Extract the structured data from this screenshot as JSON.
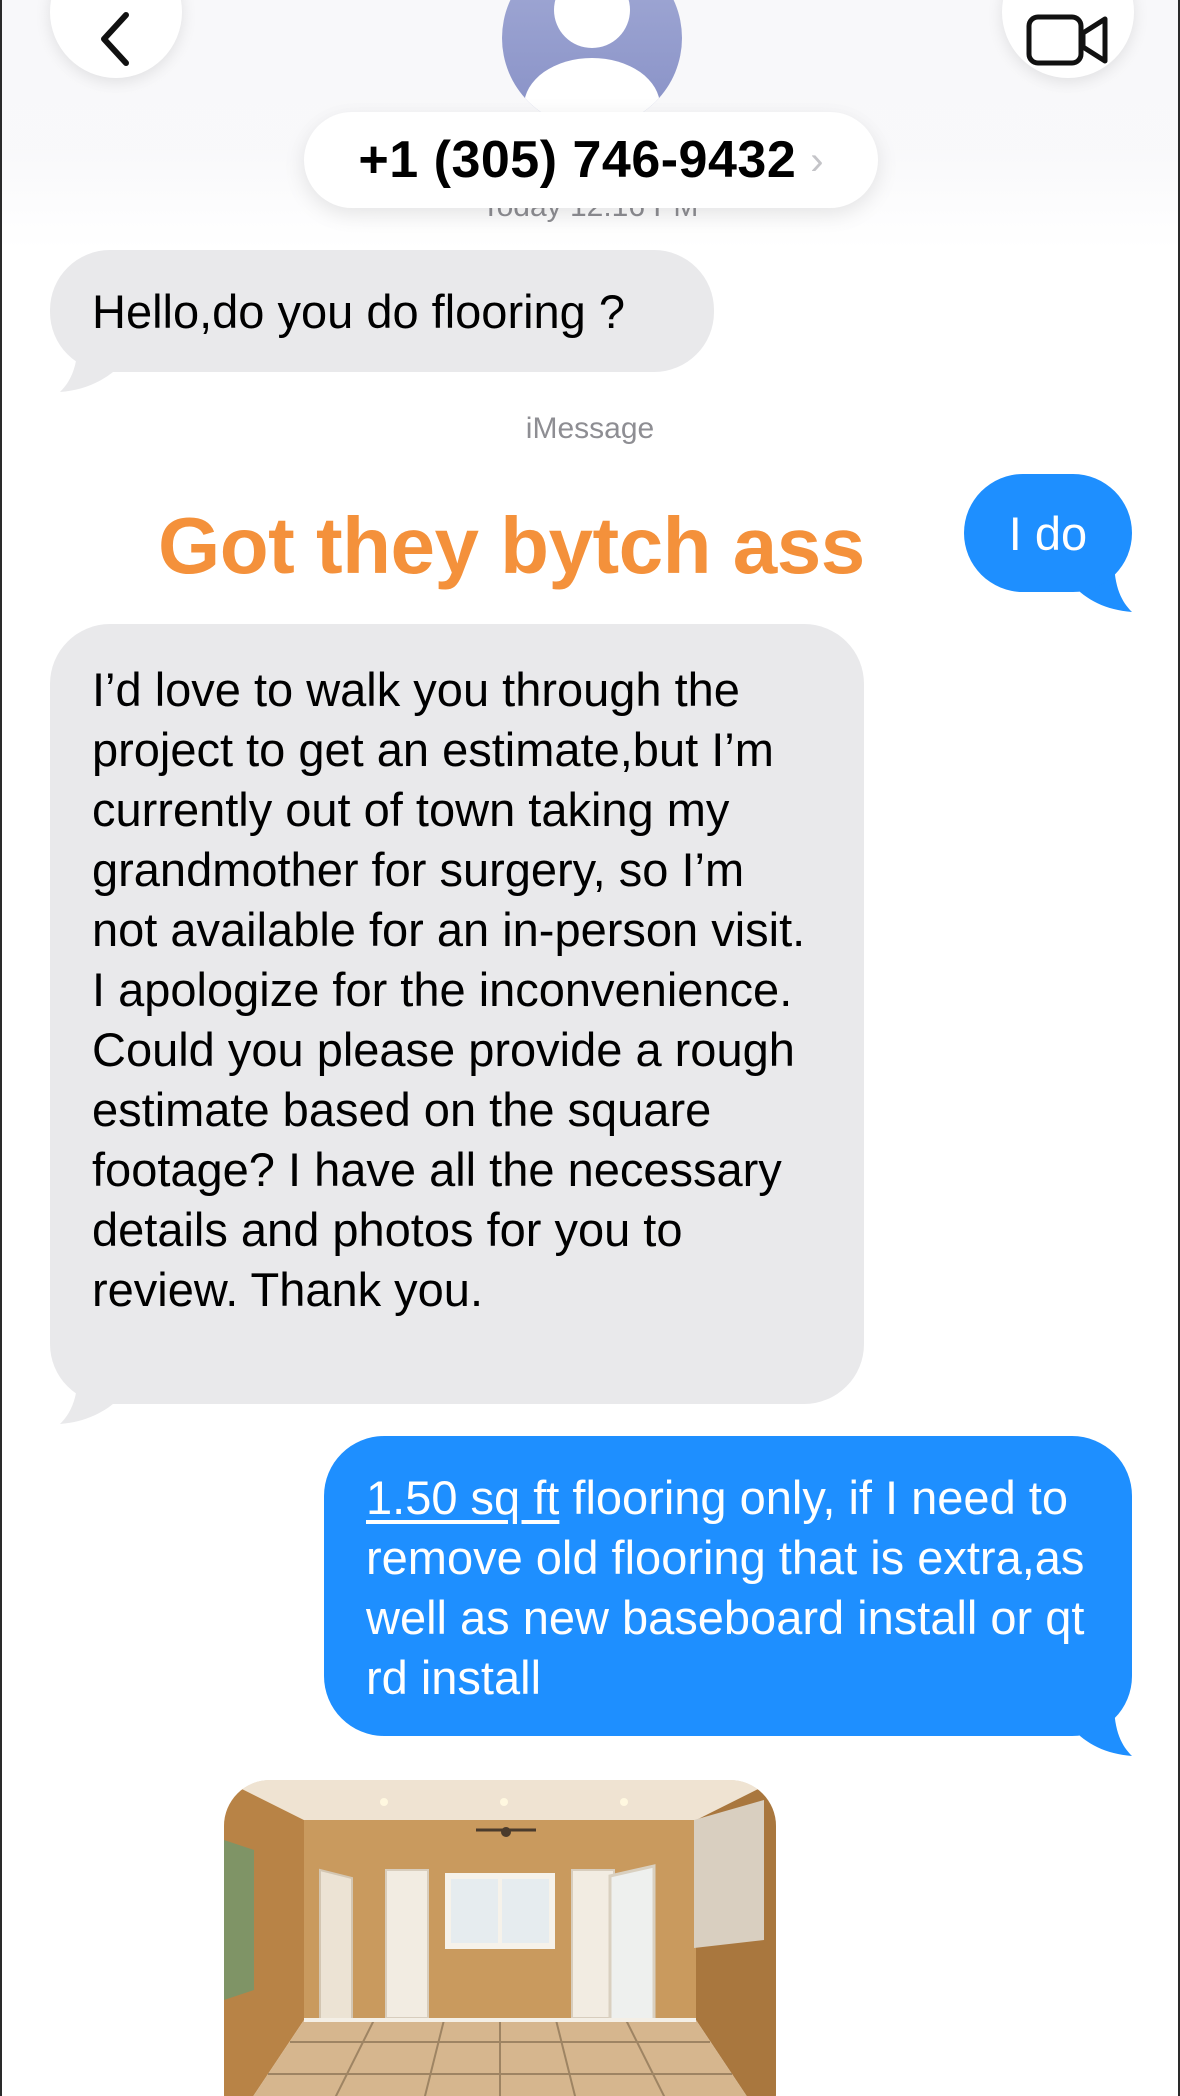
{
  "header": {
    "contact_name": "+1 (305) 746-9432",
    "chevron": "›",
    "timestamp": "Today 12:16 PM",
    "back_icon": "chevron-left-icon",
    "video_icon": "video-camera-icon",
    "avatar_icon": "person-silhouette-icon"
  },
  "messages": [
    {
      "direction": "incoming",
      "text": "Hello,do you do flooring ?"
    },
    {
      "direction": "outgoing",
      "text": "I do"
    },
    {
      "direction": "incoming",
      "text": " I’d love to walk you through the project to get an estimate,but I’m currently out of town taking my grandmother for surgery, so I’m not available for an in-person visit. I apologize for the inconvenience. Could you please provide a rough estimate based on the square footage? I have all the necessary details and photos for you to review. Thank you."
    },
    {
      "direction": "outgoing",
      "link_text": "1.50 sq ft",
      "text": " flooring only, if I need to remove old flooring that is extra,as well as new baseboard install or qt rd install"
    }
  ],
  "service_label": "iMessage",
  "overlay_caption": "Got they bytch ass",
  "attachment": {
    "type": "photo"
  },
  "colors": {
    "incoming_bubble": "#e9e9eb",
    "outgoing_bubble": "#1e8fff",
    "caption": "#f4913b",
    "avatar": "#8d96c9"
  }
}
